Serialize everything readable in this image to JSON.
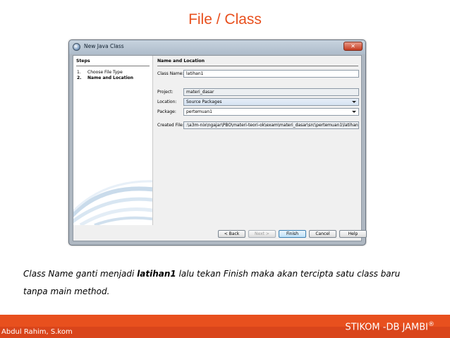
{
  "slide": {
    "title": "File / Class"
  },
  "dialog": {
    "title": "New Java Class",
    "close_glyph": "✕",
    "steps_heading": "Steps",
    "steps": [
      {
        "num": "1.",
        "label": "Choose File Type"
      },
      {
        "num": "2.",
        "label": "Name and Location"
      }
    ],
    "section_heading": "Name and Location",
    "fields": {
      "class_name": {
        "label": "Class Name:",
        "value": "latihan1"
      },
      "project": {
        "label": "Project:",
        "value": "materi_dasar"
      },
      "location": {
        "label": "Location:",
        "value": "Source Packages"
      },
      "package": {
        "label": "Package:",
        "value": "pertemuan1"
      },
      "created_file": {
        "label": "Created File:",
        "value": ":\\a3m-nix\\ngajar\\PBO\\materi-teori-ok\\exam\\materi_dasar\\src\\pertemuan1\\latihan1.java"
      }
    },
    "buttons": {
      "back": "< Back",
      "next": "Next >",
      "finish": "Finish",
      "cancel": "Cancel",
      "help": "Help"
    }
  },
  "caption": {
    "line1_before": "Class Name ganti menjadi ",
    "line1_bold": "latihan1",
    "line1_after": "  lalu tekan Finish maka akan tercipta satu class baru",
    "line2": "tanpa main method."
  },
  "footer": {
    "author": "Abdul Rahim, S.kom",
    "org": "STIKOM -DB JAMBI",
    "org_mark": "®"
  },
  "colors": {
    "accent": "#e8501e"
  }
}
